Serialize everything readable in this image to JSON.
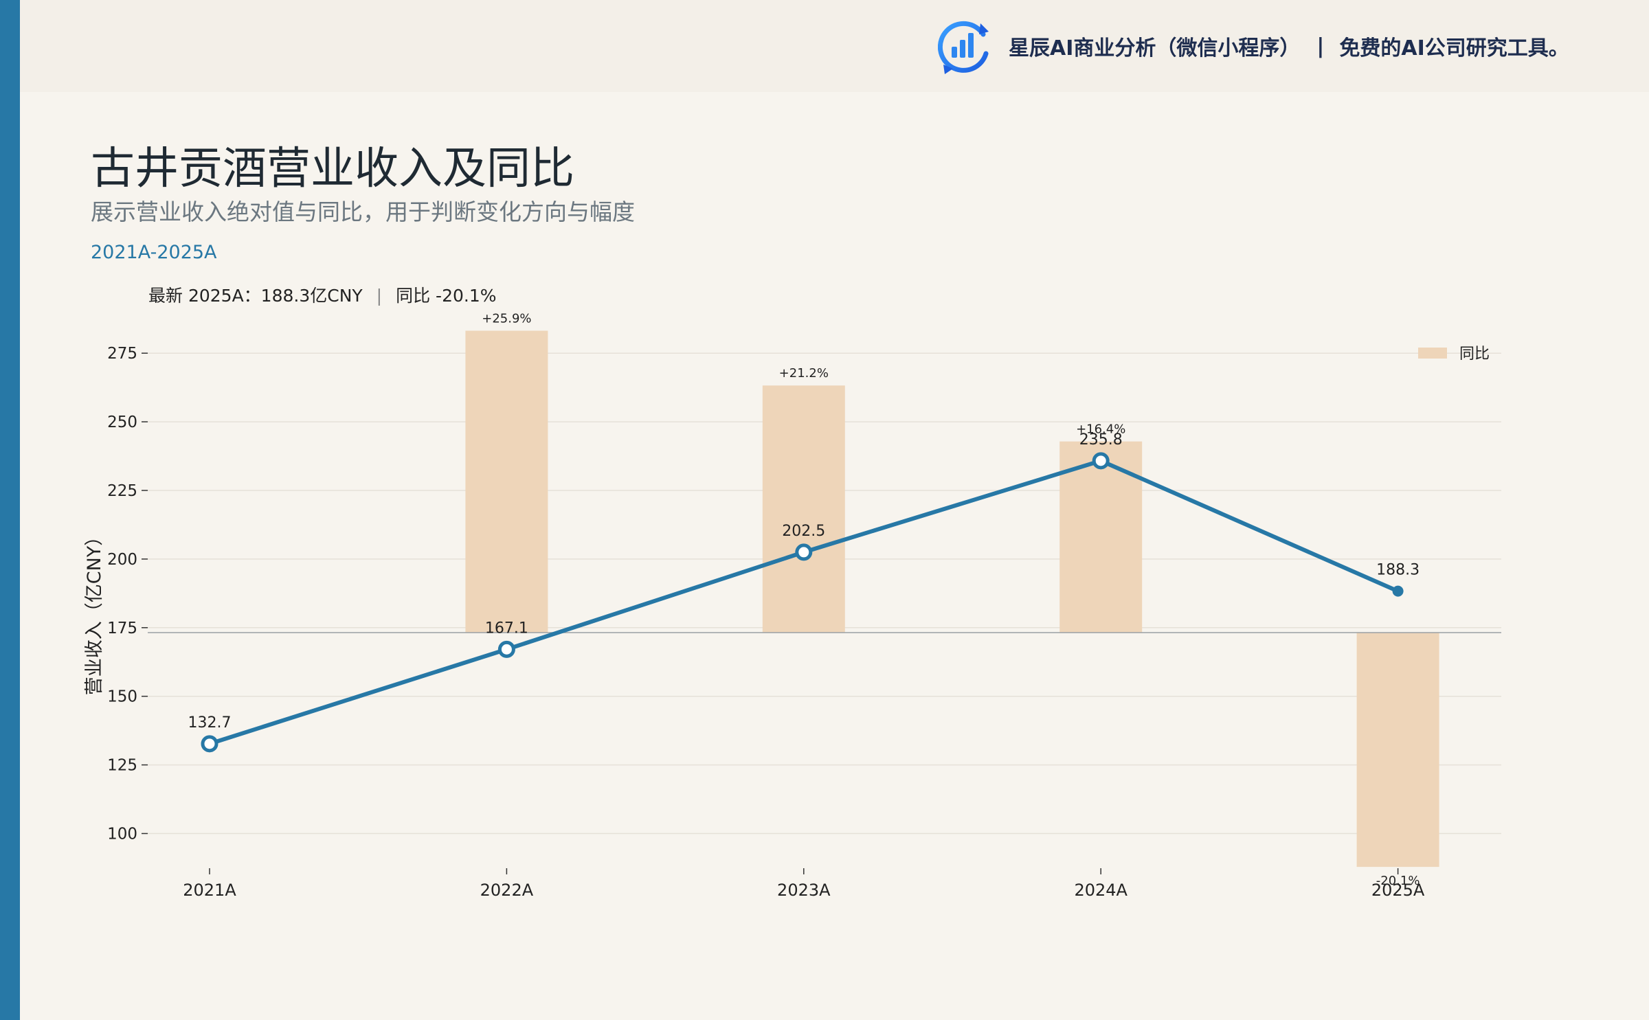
{
  "header": {
    "brand_name": "星辰AI商业分析（微信小程序）",
    "separator": "|",
    "slogan": "免费的AI公司研究工具。"
  },
  "title": "古井贡酒营业收入及同比",
  "subtitle": "展示营业收入绝对值与同比，用于判断变化方向与幅度",
  "period": "2021A-2025A",
  "latest": {
    "value_text": "最新 2025A：188.3亿CNY",
    "separator": "|",
    "yoy_text": "同比 -20.1%"
  },
  "colors": {
    "accent": "#2778a6",
    "bar": "#eed5b9",
    "background": "#f7f4ee"
  },
  "chart_data": {
    "type": "bar",
    "categories": [
      "2021A",
      "2022A",
      "2023A",
      "2024A",
      "2025A"
    ],
    "ylabel": "营业收入（亿CNY）",
    "xlabel": "",
    "ylim": [
      90,
      280
    ],
    "yticks": [
      100,
      125,
      150,
      175,
      200,
      225,
      250,
      275
    ],
    "grid": true,
    "legend_position": "top-right",
    "series": [
      {
        "type": "line",
        "values": [
          132.7,
          167.1,
          202.5,
          235.8,
          188.3
        ],
        "labels": [
          "132.7",
          "167.1",
          "202.5",
          "235.8",
          "188.3"
        ]
      },
      {
        "name": "同比",
        "type": "bar",
        "values": [
          25.9,
          21.2,
          16.4,
          -20.1
        ],
        "categories": [
          "2022A",
          "2023A",
          "2024A",
          "2025A"
        ],
        "labels": [
          "+25.9%",
          "+21.2%",
          "+16.4%",
          "-20.1%"
        ]
      }
    ]
  }
}
